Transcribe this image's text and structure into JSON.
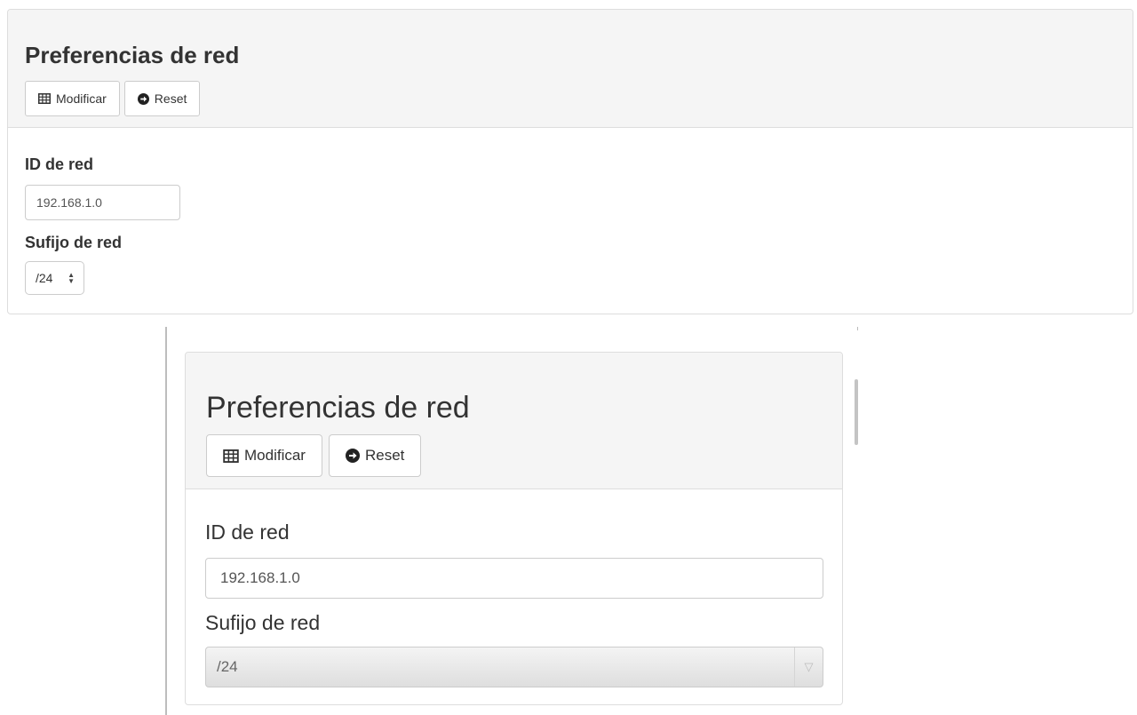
{
  "small_panel": {
    "title": "Preferencias de red",
    "buttons": {
      "modify": "Modificar",
      "reset": "Reset"
    },
    "icons": {
      "modify": "table-grid-icon",
      "reset": "arrow-circle-right-icon"
    },
    "network_id": {
      "label": "ID de red",
      "value": "192.168.1.0"
    },
    "network_suffix": {
      "label": "Sufijo de red",
      "value": "/24"
    }
  },
  "large_panel": {
    "title": "Preferencias de red",
    "buttons": {
      "modify": "Modificar",
      "reset": "Reset"
    },
    "icons": {
      "modify": "table-grid-icon",
      "reset": "arrow-circle-right-icon"
    },
    "network_id": {
      "label": "ID de red",
      "value": "192.168.1.0"
    },
    "network_suffix": {
      "label": "Sufijo de red",
      "value": "/24"
    }
  },
  "colors": {
    "heading_bg": "#f5f5f5",
    "border": "#dddddd",
    "text": "#333333"
  }
}
